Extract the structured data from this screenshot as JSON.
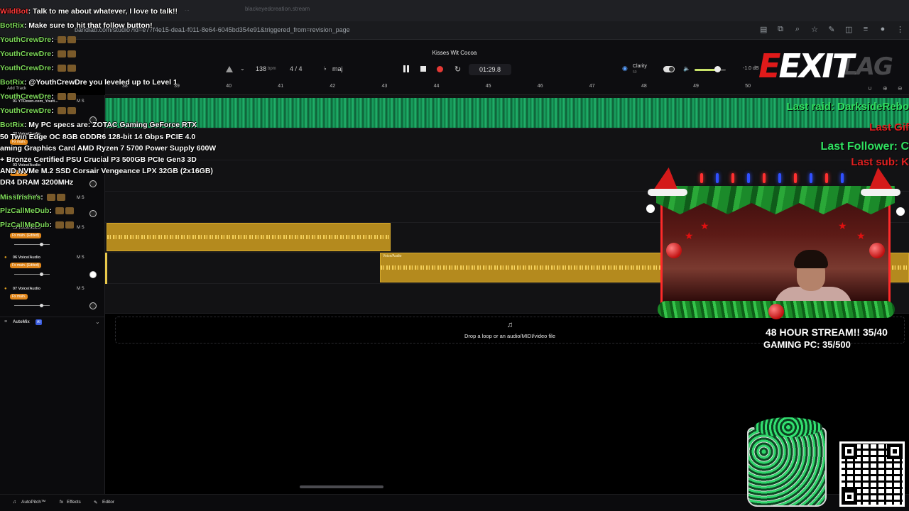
{
  "browser": {
    "url": "bandlab.com/studio?id=e77f4e15-dea1-f011-8e64-6045bd354e91&triggered_from=revision_page",
    "tab_hints": [
      "...",
      "blackeyedcreation.stream"
    ]
  },
  "studio": {
    "song_title": "Kisses Wit Cocoa",
    "tempo": "138",
    "tempo_unit": "bpm",
    "time_sig": "4 / 4",
    "key": "maj",
    "time": "01:29.8",
    "clarity_label": "Clarity",
    "clarity_sub": "50",
    "volume_db": "-1.0 dB",
    "ruler": [
      "38",
      "39",
      "40",
      "41",
      "42",
      "43",
      "44",
      "45",
      "46",
      "47",
      "48",
      "49",
      "50"
    ],
    "add_track": "Add Track",
    "tracks": [
      {
        "name": "01  YTDown.com_Youtt...",
        "fx": ""
      },
      {
        "name": "02  Voice/Audio",
        "fx": "Fx main."
      },
      {
        "name": "03  Voice/Audio",
        "fx": "Fx main."
      },
      {
        "name": "04  Voice/Audio",
        "fx": ""
      },
      {
        "name": "05  Voice/Audio",
        "fx": "Fx main. (Edited)"
      },
      {
        "name": "06  Voice/Audio",
        "fx": "Fx main. (Edited)"
      },
      {
        "name": "07  Voice/Audio",
        "fx": "Fx main."
      }
    ],
    "region_label": "Voice/Audio",
    "automix": "AutoMix",
    "ai_badge": "AI",
    "drop_text": "Drop a loop or an audio/MIDI/video file",
    "bottom": {
      "autopitch": "AutoPitch™",
      "effects": "Effects",
      "editor": "Editor"
    },
    "ms_labels": "M  S"
  },
  "overlay": {
    "chat": [
      {
        "user": "WildBot",
        "text": ": Talk to me about whatever, I love to talk!!"
      },
      {
        "user": "BotRix",
        "text": ": Make sure to hit that follow button!"
      },
      {
        "user": "YouthCrewDre",
        "text": ": "
      },
      {
        "user": "YouthCrewDre",
        "text": ": "
      },
      {
        "user": "YouthCrewDre",
        "text": ": "
      },
      {
        "user": "BotRix",
        "text": ": @YouthCrewDre you leveled up to Level 1"
      },
      {
        "user": "YouthCrewDre",
        "text": ": "
      },
      {
        "user": "YouthCrewDre",
        "text": ": "
      },
      {
        "user": "BotRix",
        "text": ": My PC specs are: ZOTAC Gaming GeForce RTX"
      },
      {
        "user": "",
        "text": "50 Twin Edge OC 8GB GDDR6 128-bit 14 Gbps PCIE 4.0"
      },
      {
        "user": "",
        "text": "aming Graphics Card AMD Ryzen 7 5700 Power Supply 600W"
      },
      {
        "user": "",
        "text": "+ Bronze Certified PSU Crucial P3 500GB PCIe Gen3 3D"
      },
      {
        "user": "",
        "text": "AND NVMe M.2 SSD Corsair Vengeance LPX 32GB (2x16GB)"
      },
      {
        "user": "",
        "text": "DR4 DRAM 3200MHz"
      },
      {
        "user": "MissIrishes",
        "text": ": "
      },
      {
        "user": "PlzCallMeDub",
        "text": ": "
      },
      {
        "user": "PlzCallMeDub",
        "text": ": "
      }
    ],
    "logo_main": "EXIT",
    "logo_lag": "LAG",
    "last_raid": "Last raid: DarksideRebo",
    "last_gift": "Last Gif",
    "last_follower": "Last Follower: C",
    "last_sub": "Last sub: K",
    "goal_stream": "48 HOUR STREAM!! 35/40",
    "goal_pc": "GAMING PC: 35/500"
  },
  "colors": {
    "accent_green": "#30e060",
    "accent_red": "#e02020",
    "region_gold": "#b48a1e",
    "region_green": "#1bb26a"
  }
}
